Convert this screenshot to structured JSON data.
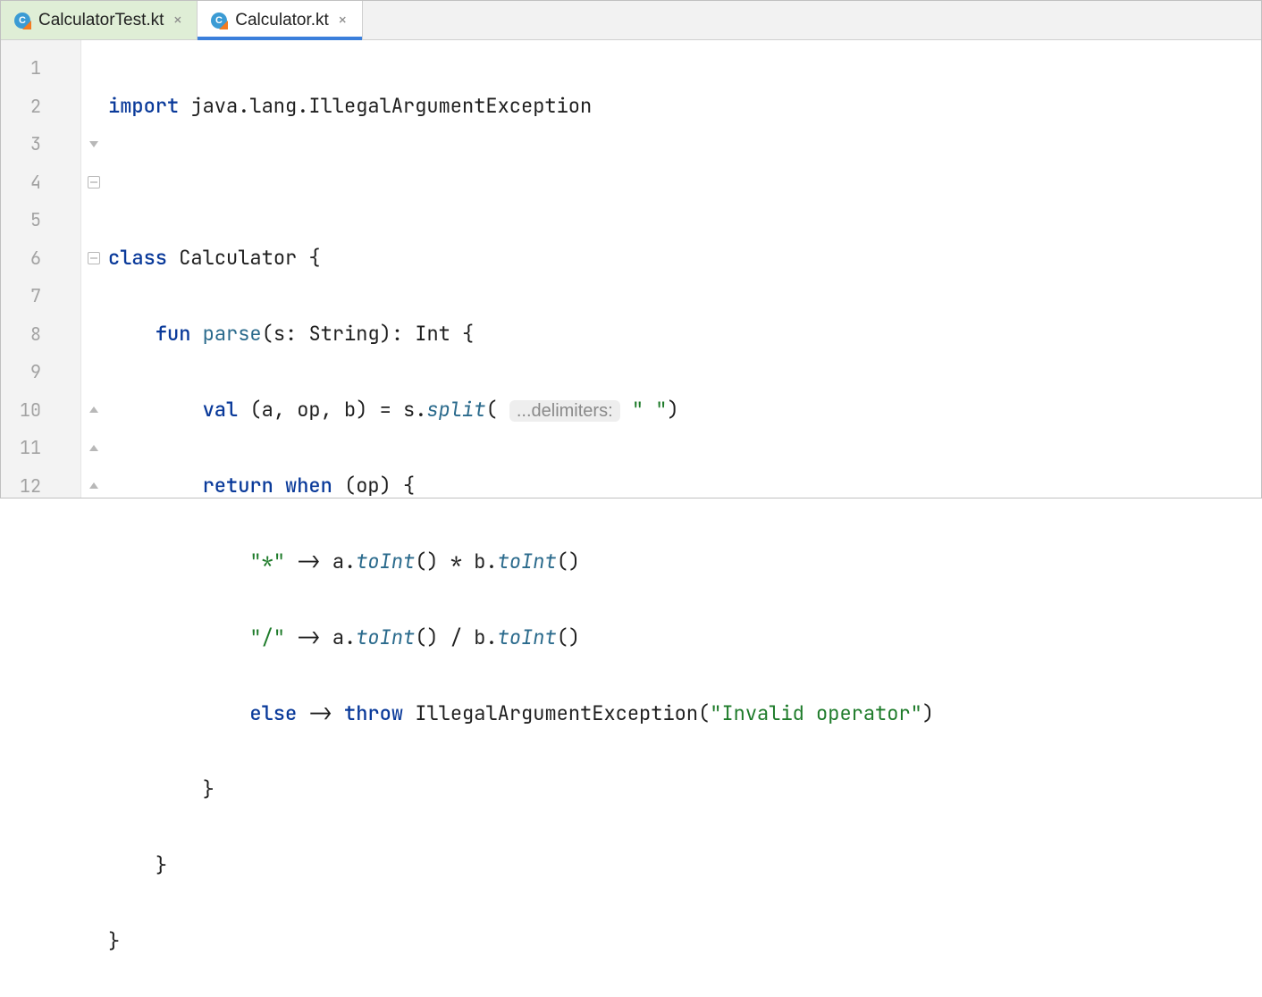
{
  "tabs": [
    {
      "label": "CalculatorTest.kt",
      "icon": "kotlin-file-icon"
    },
    {
      "label": "Calculator.kt",
      "icon": "kotlin-file-icon"
    }
  ],
  "gutter": [
    "1",
    "2",
    "3",
    "4",
    "5",
    "6",
    "7",
    "8",
    "9",
    "10",
    "11",
    "12"
  ],
  "hint": {
    "label": "...delimiters:"
  },
  "code": {
    "l1": {
      "kw_import": "import",
      "rest": " java.lang.IllegalArgumentException"
    },
    "l3": {
      "kw_class": "class",
      "rest": " Calculator {"
    },
    "l4": {
      "kw_fun": "fun",
      "sp": " ",
      "fn": "parse",
      "rest": "(s: String): Int {"
    },
    "l5": {
      "kw_val": "val",
      "mid": " (a, op, b) = s.",
      "it": "split",
      "open": "(",
      "sp2": " ",
      "str": "\" \"",
      "close": ")"
    },
    "l6": {
      "kw_return": "return",
      "sp": " ",
      "kw_when": "when",
      "rest": " (op) {"
    },
    "l7": {
      "str": "\"*\"",
      "arrow": " -> a.",
      "it1": "toInt",
      "mid": "() * b.",
      "it2": "toInt",
      "end": "()"
    },
    "l8": {
      "str": "\"/\"",
      "arrow": " -> a.",
      "it1": "toInt",
      "mid": "() / b.",
      "it2": "toInt",
      "end": "()"
    },
    "l9": {
      "kw_else": "else",
      "arrow": " -> ",
      "kw_throw": "throw",
      "sp": " IllegalArgumentException(",
      "str": "\"Invalid operator\"",
      "close": ")"
    },
    "l10": {
      "text": "}"
    },
    "l11": {
      "text": "}"
    },
    "l12": {
      "text": "}"
    }
  }
}
